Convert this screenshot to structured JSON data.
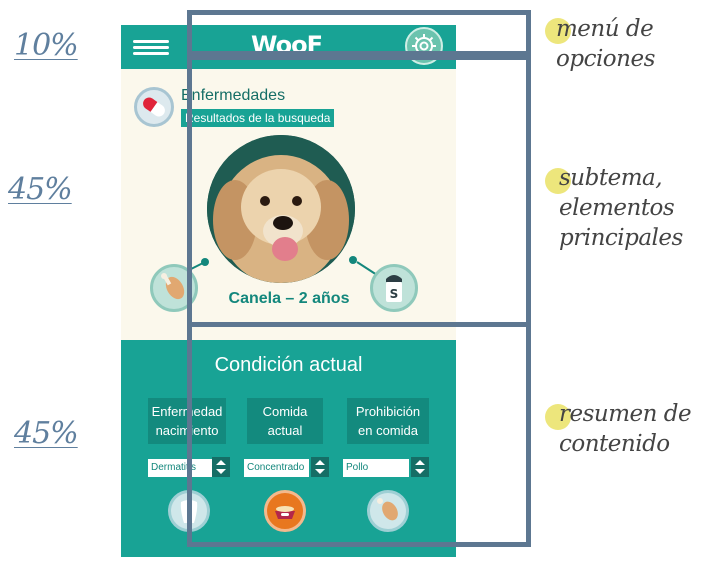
{
  "labels": {
    "top": "10%",
    "middle": "45%",
    "bottom": "45%"
  },
  "app": {
    "logo": "WooF",
    "disease_title": "Enfermedades",
    "disease_subtitle": "Resultados de la busqueda",
    "pet_name": "Canela – 2 años"
  },
  "summary": {
    "title": "Condición actual",
    "categories": [
      {
        "line1": "Enfermedad",
        "line2": "nacimiento",
        "selected": "Dermatitis"
      },
      {
        "line1": "Comida",
        "line2": "actual",
        "selected": "Concentrado"
      },
      {
        "line1": "Prohibición",
        "line2": "en comida",
        "selected": "Pollo"
      }
    ]
  },
  "annotations": {
    "menu": {
      "line1": "menú de",
      "line2": "opciones"
    },
    "subtopic": {
      "line1": "subtema,",
      "line2": "elementos",
      "line3": "principales"
    },
    "summary": {
      "line1": "resumen de",
      "line2": "contenido"
    }
  },
  "colors": {
    "teal": "#18a395",
    "dark_teal": "#138a7e",
    "cream": "#fbf8ec",
    "frame": "#5d7791",
    "highlight": "#ede67c"
  },
  "icons": [
    "menu-icon",
    "gear-icon",
    "pill-icon",
    "drumstick-icon",
    "salt-shaker-icon",
    "tooth-icon",
    "dog-bowl-icon"
  ]
}
